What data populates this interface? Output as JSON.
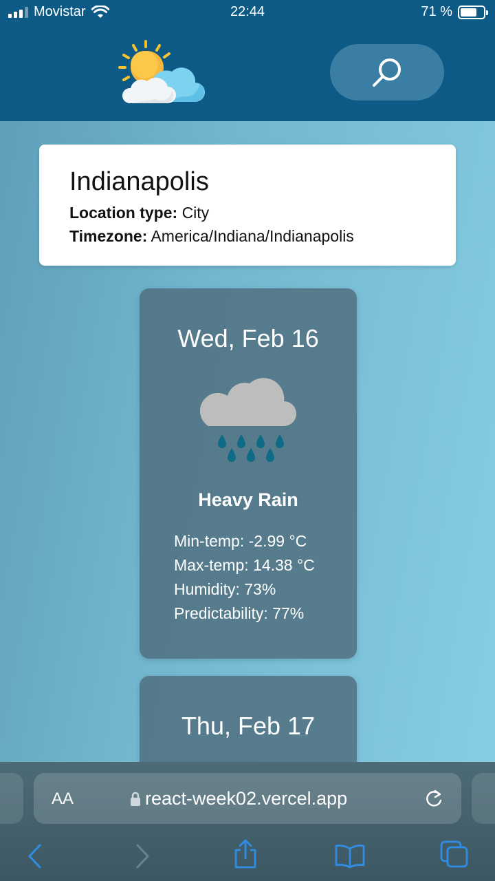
{
  "status": {
    "carrier": "Movistar",
    "time": "22:44",
    "battery_text": "71 %",
    "battery_level": 0.71
  },
  "header": {
    "logo_icon": "sun-cloud-icon",
    "search_icon": "search-icon"
  },
  "location": {
    "city": "Indianapolis",
    "type_label": "Location type:",
    "type_value": "City",
    "timezone_label": "Timezone:",
    "timezone_value": "America/Indiana/Indianapolis"
  },
  "forecast": [
    {
      "date": "Wed, Feb 16",
      "icon": "heavy-rain-icon",
      "condition": "Heavy Rain",
      "min_temp": "Min-temp: -2.99 °C",
      "max_temp": "Max-temp: 14.38 °C",
      "humidity": "Humidity: 73%",
      "predictability": "Predictability: 77%"
    },
    {
      "date": "Thu, Feb 17"
    }
  ],
  "browser": {
    "aa_label": "AA",
    "url": "react-week02.vercel.app"
  },
  "colors": {
    "header_bg": "#0d5a86",
    "search_bg": "#3b7ea3",
    "card_bg": "#507080",
    "rain_drop": "#0d6b86"
  }
}
